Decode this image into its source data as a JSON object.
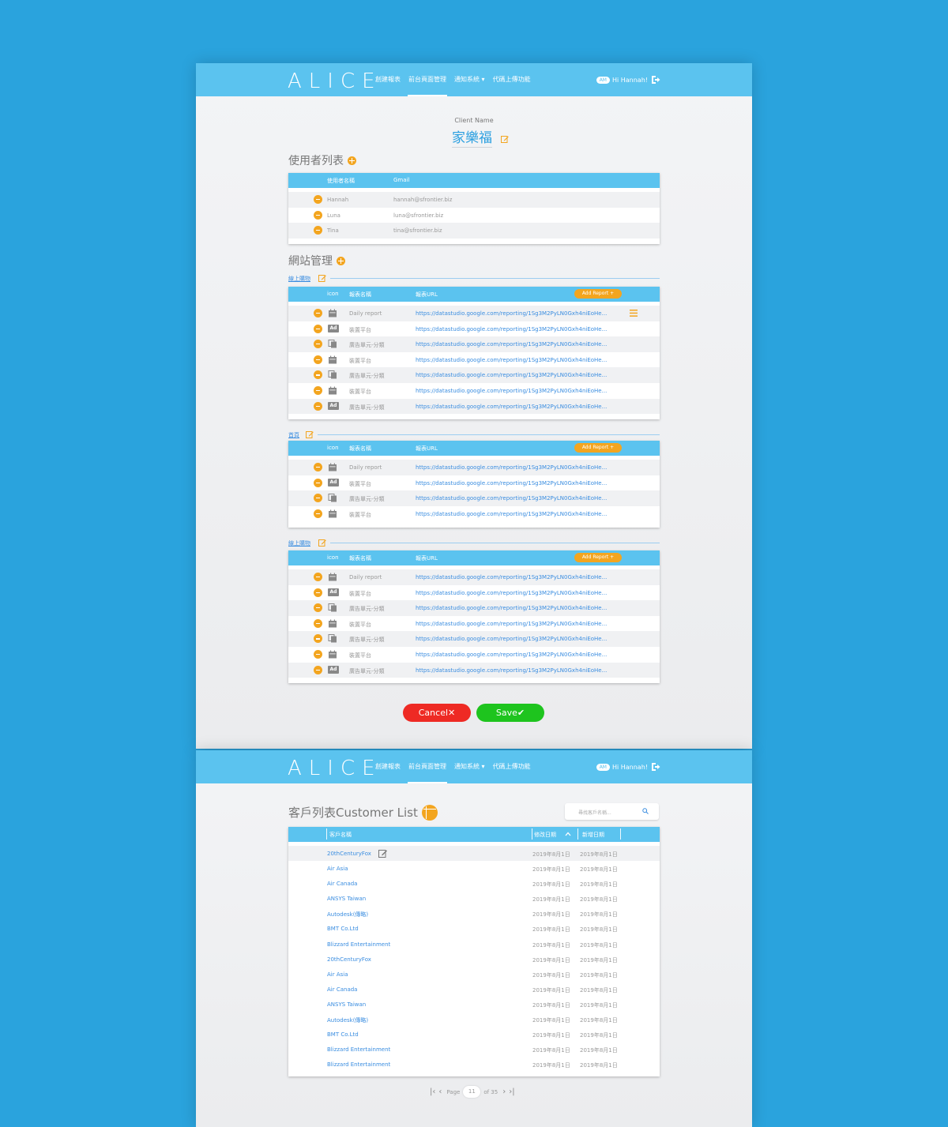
{
  "app": {
    "logo": "ALICE"
  },
  "nav": {
    "items": [
      {
        "label": "創建報表"
      },
      {
        "label": "前台頁面管理"
      },
      {
        "label": "通知系統 ▾"
      },
      {
        "label": "代碼上傳功能"
      }
    ],
    "avatar": "AM",
    "greeting": "Hi Hannah!"
  },
  "client": {
    "label": "Client Name",
    "name": "家樂福"
  },
  "users": {
    "title": "使用者列表",
    "headers": {
      "name": "使用者名稱",
      "gmail": "Gmail"
    },
    "rows": [
      {
        "name": "Hannah",
        "gmail": "hannah@sfrontier.biz"
      },
      {
        "name": "Luna",
        "gmail": "luna@sfrontier.biz"
      },
      {
        "name": "Tina",
        "gmail": "tina@sfrontier.biz"
      }
    ]
  },
  "sites": {
    "title": "網站管理",
    "headers": {
      "icon": "icon",
      "name": "報表名稱",
      "url": "報表URL"
    },
    "add_report": "Add Report +",
    "groups": [
      {
        "name": "線上購物",
        "rows": [
          {
            "icon": "calendar",
            "name": "Daily report",
            "url": "https://datastudio.google.com/reporting/1Sg3M2PyLN0Gxh4niEoHe..."
          },
          {
            "icon": "ad",
            "name": "裝置平台",
            "url": "https://datastudio.google.com/reporting/1Sg3M2PyLN0Gxh4niEoHe..."
          },
          {
            "icon": "copy",
            "name": "廣告單元-分類",
            "url": "https://datastudio.google.com/reporting/1Sg3M2PyLN0Gxh4niEoHe..."
          },
          {
            "icon": "calendar",
            "name": "裝置平台",
            "url": "https://datastudio.google.com/reporting/1Sg3M2PyLN0Gxh4niEoHe..."
          },
          {
            "icon": "copy",
            "name": "廣告單元-分類",
            "url": "https://datastudio.google.com/reporting/1Sg3M2PyLN0Gxh4niEoHe..."
          },
          {
            "icon": "calendar",
            "name": "裝置平台",
            "url": "https://datastudio.google.com/reporting/1Sg3M2PyLN0Gxh4niEoHe..."
          },
          {
            "icon": "ad",
            "name": "廣告單元-分類",
            "url": "https://datastudio.google.com/reporting/1Sg3M2PyLN0Gxh4niEoHe..."
          }
        ]
      },
      {
        "name": "首頁",
        "rows": [
          {
            "icon": "calendar",
            "name": "Daily report",
            "url": "https://datastudio.google.com/reporting/1Sg3M2PyLN0Gxh4niEoHe..."
          },
          {
            "icon": "ad",
            "name": "裝置平台",
            "url": "https://datastudio.google.com/reporting/1Sg3M2PyLN0Gxh4niEoHe..."
          },
          {
            "icon": "copy",
            "name": "廣告單元-分類",
            "url": "https://datastudio.google.com/reporting/1Sg3M2PyLN0Gxh4niEoHe..."
          },
          {
            "icon": "calendar",
            "name": "裝置平台",
            "url": "https://datastudio.google.com/reporting/1Sg3M2PyLN0Gxh4niEoHe..."
          }
        ]
      },
      {
        "name": "線上購物",
        "rows": [
          {
            "icon": "calendar",
            "name": "Daily report",
            "url": "https://datastudio.google.com/reporting/1Sg3M2PyLN0Gxh4niEoHe..."
          },
          {
            "icon": "ad",
            "name": "裝置平台",
            "url": "https://datastudio.google.com/reporting/1Sg3M2PyLN0Gxh4niEoHe..."
          },
          {
            "icon": "copy",
            "name": "廣告單元-分類",
            "url": "https://datastudio.google.com/reporting/1Sg3M2PyLN0Gxh4niEoHe..."
          },
          {
            "icon": "calendar",
            "name": "裝置平台",
            "url": "https://datastudio.google.com/reporting/1Sg3M2PyLN0Gxh4niEoHe..."
          },
          {
            "icon": "copy",
            "name": "廣告單元-分類",
            "url": "https://datastudio.google.com/reporting/1Sg3M2PyLN0Gxh4niEoHe..."
          },
          {
            "icon": "calendar",
            "name": "裝置平台",
            "url": "https://datastudio.google.com/reporting/1Sg3M2PyLN0Gxh4niEoHe..."
          },
          {
            "icon": "ad",
            "name": "廣告單元-分類",
            "url": "https://datastudio.google.com/reporting/1Sg3M2PyLN0Gxh4niEoHe..."
          }
        ]
      }
    ]
  },
  "actions": {
    "cancel": "Cancel✕",
    "save": "Save✔"
  },
  "customers": {
    "title": "客戶列表Customer List",
    "search_placeholder": "尋找客戶名稱...",
    "headers": {
      "name": "客戶名稱",
      "modified": "修改日期",
      "created": "新增日期"
    },
    "rows": [
      {
        "name": "20thCenturyFox",
        "modified": "2019年8月1日",
        "created": "2019年8月1日"
      },
      {
        "name": "Air Asia",
        "modified": "2019年8月1日",
        "created": "2019年8月1日"
      },
      {
        "name": "Air Canada",
        "modified": "2019年8月1日",
        "created": "2019年8月1日"
      },
      {
        "name": "ANSYS Taiwan",
        "modified": "2019年8月1日",
        "created": "2019年8月1日"
      },
      {
        "name": "Autodesk(傳略)",
        "modified": "2019年8月1日",
        "created": "2019年8月1日"
      },
      {
        "name": "BMT Co.Ltd",
        "modified": "2019年8月1日",
        "created": "2019年8月1日"
      },
      {
        "name": "Blizzard Entertainment",
        "modified": "2019年8月1日",
        "created": "2019年8月1日"
      },
      {
        "name": "20thCenturyFox",
        "modified": "2019年8月1日",
        "created": "2019年8月1日"
      },
      {
        "name": "Air Asia",
        "modified": "2019年8月1日",
        "created": "2019年8月1日"
      },
      {
        "name": "Air Canada",
        "modified": "2019年8月1日",
        "created": "2019年8月1日"
      },
      {
        "name": "ANSYS Taiwan",
        "modified": "2019年8月1日",
        "created": "2019年8月1日"
      },
      {
        "name": "Autodesk(傳略)",
        "modified": "2019年8月1日",
        "created": "2019年8月1日"
      },
      {
        "name": "BMT Co.Ltd",
        "modified": "2019年8月1日",
        "created": "2019年8月1日"
      },
      {
        "name": "Blizzard Entertainment",
        "modified": "2019年8月1日",
        "created": "2019年8月1日"
      },
      {
        "name": "Blizzard Entertainment",
        "modified": "2019年8月1日",
        "created": "2019年8月1日"
      }
    ]
  },
  "pagination": {
    "page_label": "Page",
    "current": "11",
    "total_label": "of 35"
  },
  "colors": {
    "primary": "#5bc3ef",
    "accent": "#f3a51f",
    "cancel": "#ee2a24",
    "save": "#1ec41e",
    "link": "#3a8de0"
  }
}
